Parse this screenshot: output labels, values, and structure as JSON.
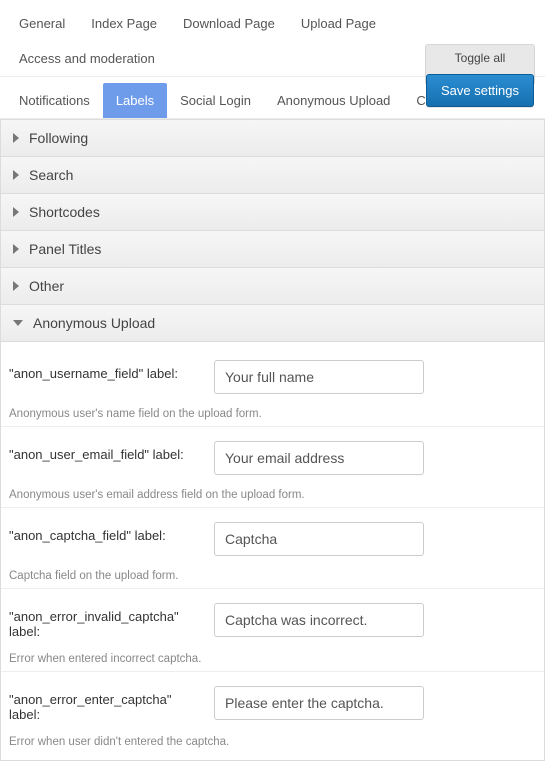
{
  "tabs": {
    "row1": [
      "General",
      "Index Page",
      "Download Page",
      "Upload Page",
      "Access and moderation"
    ],
    "row2": [
      "Notifications",
      "Labels",
      "Social Login",
      "Anonymous Upload",
      "Custom CSS"
    ],
    "active": "Labels"
  },
  "actions": {
    "toggle_all": "Toggle all",
    "save": "Save settings"
  },
  "sections": {
    "following": "Following",
    "search": "Search",
    "shortcodes": "Shortcodes",
    "panel_titles": "Panel Titles",
    "other": "Other",
    "anon_upload": "Anonymous Upload"
  },
  "fields": {
    "anon_username_field": {
      "label": "\"anon_username_field\" label:",
      "value": "Your full name",
      "help": "Anonymous user's name field on the upload form."
    },
    "anon_user_email_field": {
      "label": "\"anon_user_email_field\" label:",
      "value": "Your email address",
      "help": "Anonymous user's email address field on the upload form."
    },
    "anon_captcha_field": {
      "label": "\"anon_captcha_field\" label:",
      "value": "Captcha",
      "help": "Captcha field on the upload form."
    },
    "anon_error_invalid_captcha": {
      "label": "\"anon_error_invalid_captcha\" label:",
      "value": "Captcha was incorrect.",
      "help": "Error when entered incorrect captcha."
    },
    "anon_error_enter_captcha": {
      "label": "\"anon_error_enter_captcha\" label:",
      "value": "Please enter the captcha.",
      "help": "Error when user didn't entered the captcha."
    }
  }
}
